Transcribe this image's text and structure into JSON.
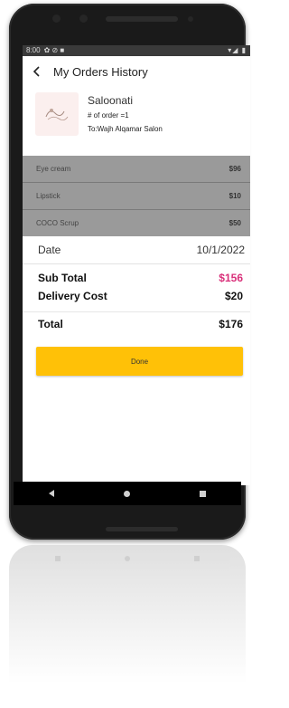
{
  "status_bar": {
    "time": "8:00",
    "left_icons": "✿ ⊘ ■",
    "right_icons": "▾◢ ▮"
  },
  "header": {
    "title": "My Orders History"
  },
  "store": {
    "name": "Saloonati",
    "order_count": "# of order =1",
    "to": "To:Wajh Alqamar Salon"
  },
  "items": [
    {
      "name": "Eye cream",
      "price": "$96"
    },
    {
      "name": "Lipstick",
      "price": "$10"
    },
    {
      "name": "COCO Scrup",
      "price": "$50"
    }
  ],
  "date": {
    "label": "Date",
    "value": "10/1/2022"
  },
  "summary": {
    "subtotal_label": "Sub Total",
    "subtotal_value": "$156",
    "delivery_label": "Delivery Cost",
    "delivery_value": "$20",
    "total_label": "Total",
    "total_value": "$176"
  },
  "done_button": {
    "label": "Done"
  },
  "colors": {
    "accent": "#ffc107",
    "subtotal": "#d9307a",
    "items_bg": "#9a9a9a"
  },
  "icons": [
    "back-arrow-icon",
    "store-logo-icon",
    "nav-back-icon",
    "nav-home-icon",
    "nav-recent-icon"
  ]
}
